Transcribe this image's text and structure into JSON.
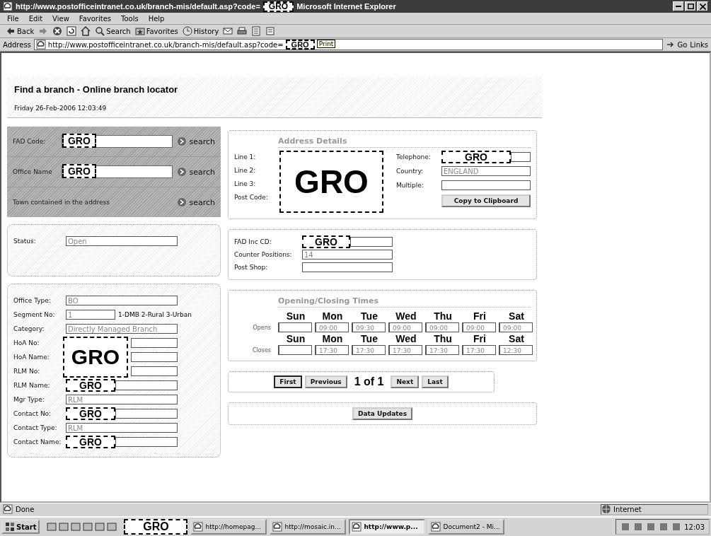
{
  "window": {
    "title_before": "http://www.postofficeintranet.co.uk/branch-mis/default.asp?code=",
    "title_redaction": "GRO",
    "title_after": "Microsoft Internet Explorer"
  },
  "menu": [
    "File",
    "Edit",
    "View",
    "Favorites",
    "Tools",
    "Help"
  ],
  "toolbar": [
    {
      "kind": "back",
      "label": "Back"
    },
    {
      "kind": "forward"
    },
    {
      "kind": "stop"
    },
    {
      "kind": "refresh"
    },
    {
      "kind": "home"
    },
    {
      "kind": "search",
      "label": "Search"
    },
    {
      "kind": "favorites",
      "label": "Favorites"
    },
    {
      "kind": "history",
      "label": "History"
    },
    {
      "kind": "mail"
    },
    {
      "kind": "print"
    },
    {
      "kind": "edit"
    },
    {
      "kind": "discuss"
    }
  ],
  "address_bar": {
    "label": "Address",
    "url": "http://www.postofficeintranet.co.uk/branch-mis/default.asp?code=",
    "redaction": "GRO",
    "tooltip": "Print",
    "go": "Go",
    "links": "Links"
  },
  "page": {
    "title": "Find a branch - Online branch locator",
    "date": "Friday 26-Feb-2006 12:03:49",
    "search": [
      {
        "label": "FAD Code:",
        "redaction": "GRO",
        "link": "search"
      },
      {
        "label": "Office Name",
        "redaction": "GRO",
        "link": "search"
      },
      {
        "label": "Town contained in the address",
        "link": "search"
      }
    ],
    "status": {
      "label": "Status:",
      "value": "Open"
    },
    "details": [
      {
        "label": "Office Type:",
        "value": "BO"
      },
      {
        "label": "Segment No:",
        "value": "1",
        "note": "1-DMB  2-Rural  3-Urban"
      },
      {
        "label": "Category:",
        "value": "Directly Managed Branch"
      },
      {
        "kind": "redacted_group",
        "labels": [
          "HoA No:",
          "HoA Name:",
          "RLM No:"
        ],
        "redaction": "GRO"
      },
      {
        "label": "RLM Name:",
        "redaction": "GRO"
      },
      {
        "label": "Mgr Type:",
        "value": "RLM"
      },
      {
        "label": "Contact No:",
        "redaction": "GRO"
      },
      {
        "label": "Contact Type:",
        "value": "RLM"
      },
      {
        "label": "Contact Name:",
        "redaction": "GRO"
      }
    ],
    "address": {
      "title": "Address Details",
      "lines": [
        "Line 1:",
        "Line 2:",
        "Line 3:",
        "Post Code:"
      ],
      "redaction": "GRO",
      "fields": [
        {
          "label": "Telephone:",
          "redaction": "GRO"
        },
        {
          "label": "Country:",
          "value": "ENGLAND"
        },
        {
          "label": "Multiple:"
        }
      ],
      "button": "Copy to Clipboard"
    },
    "office": [
      {
        "label": "FAD Inc CD:",
        "redaction": "GRO"
      },
      {
        "label": "Counter Positions:",
        "value": "14"
      },
      {
        "label": "Post Shop:"
      }
    ],
    "times": {
      "title": "Opening/Closing Times",
      "rows": [
        {
          "label": "Opens",
          "cells": [
            {
              "day": "Sun"
            },
            {
              "day": "Mon",
              "value": "09:00"
            },
            {
              "day": "Tue",
              "value": "09:30"
            },
            {
              "day": "Wed",
              "value": "09:00"
            },
            {
              "day": "Thu",
              "value": "09:00"
            },
            {
              "day": "Fri",
              "value": "09:00"
            },
            {
              "day": "Sat",
              "value": "09:00"
            }
          ]
        },
        {
          "label": "Closes",
          "cells": [
            {
              "day": "Sun"
            },
            {
              "day": "Mon",
              "value": "17:30"
            },
            {
              "day": "Tue",
              "value": "17:30"
            },
            {
              "day": "Wed",
              "value": "17:30"
            },
            {
              "day": "Thu",
              "value": "17:30"
            },
            {
              "day": "Fri",
              "value": "17:30"
            },
            {
              "day": "Sat",
              "value": "12:30"
            }
          ]
        }
      ]
    },
    "pager": {
      "buttons": [
        {
          "label": "First",
          "selected": true
        },
        {
          "label": "Previous",
          "selected": false
        },
        {
          "label": "Next",
          "selected": false
        },
        {
          "label": "Last",
          "selected": false
        }
      ],
      "position": "1 of 1"
    },
    "data_button": "Data Updates"
  },
  "status_bar": {
    "text": "Done",
    "zone": "Internet"
  },
  "taskbar": {
    "start": "Start",
    "redaction": "GRO",
    "tasks": [
      {
        "label": "http://homepag...",
        "selected": false
      },
      {
        "label": "http://mosaic.in...",
        "selected": false
      },
      {
        "label": "http://www.p...",
        "selected": true
      },
      {
        "label": "Document2 - Mi...",
        "selected": false
      }
    ],
    "clock": "12:03"
  }
}
